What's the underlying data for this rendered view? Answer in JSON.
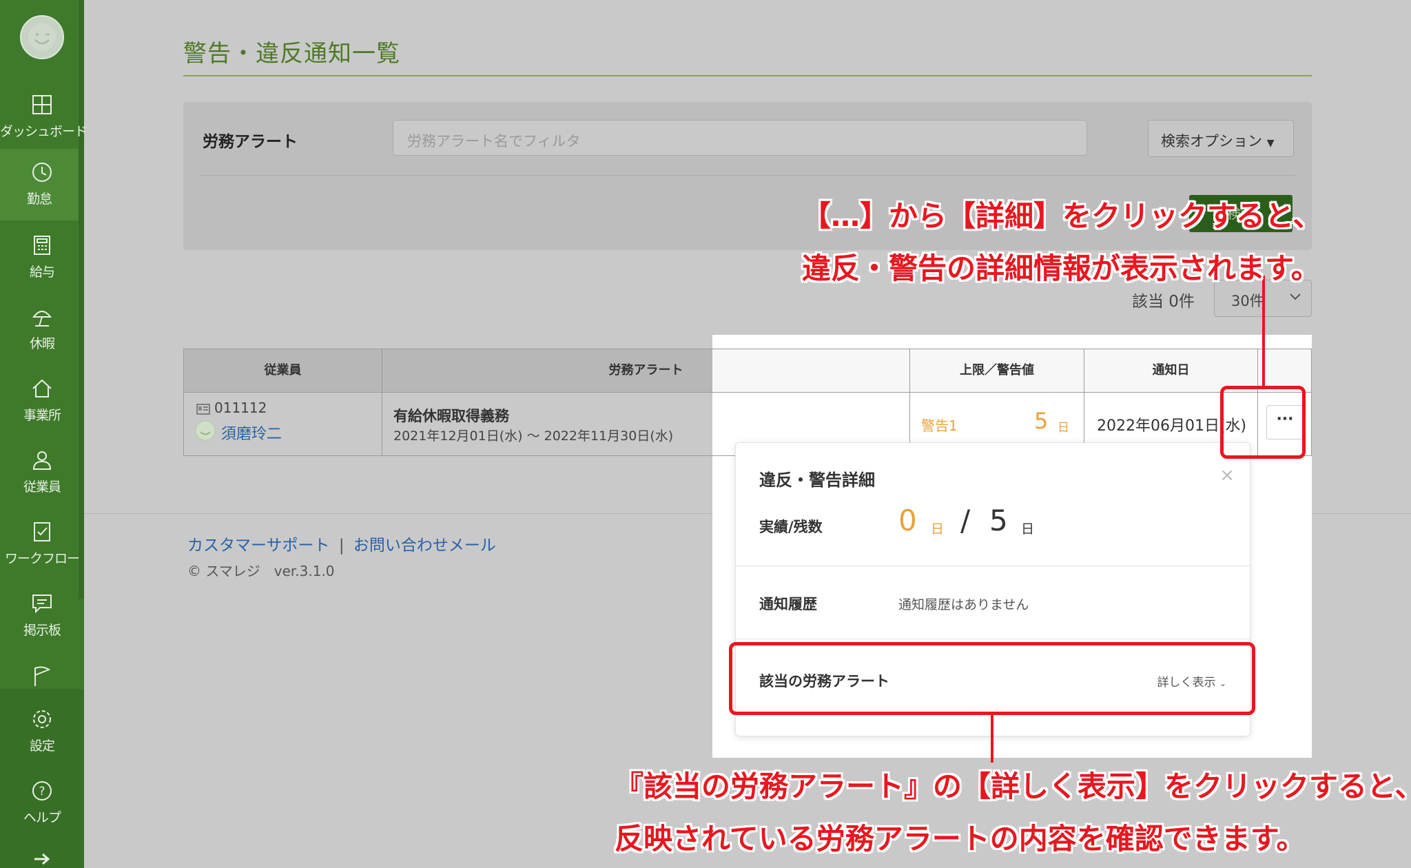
{
  "sidebar": {
    "items": [
      {
        "label": "ダッシュボード",
        "icon": "dashboard-icon"
      },
      {
        "label": "勤怠",
        "icon": "clock-icon"
      },
      {
        "label": "給与",
        "icon": "calculator-icon"
      },
      {
        "label": "休暇",
        "icon": "beach-umbrella-icon"
      },
      {
        "label": "事業所",
        "icon": "home-icon"
      },
      {
        "label": "従業員",
        "icon": "person-icon"
      },
      {
        "label": "ワークフロー",
        "icon": "clipboard-check-icon"
      },
      {
        "label": "掲示板",
        "icon": "message-icon"
      },
      {
        "label": "",
        "icon": "flag-icon"
      },
      {
        "label": "設定",
        "icon": "gear-icon"
      },
      {
        "label": "ヘルプ",
        "icon": "help-icon"
      }
    ]
  },
  "page": {
    "title": "警告・違反通知一覧"
  },
  "filter": {
    "label": "労務アラート",
    "placeholder": "労務アラート名でフィルタ",
    "search_options": "検索オプション",
    "search_button": "検索"
  },
  "results": {
    "count": "該当 0件",
    "per_page": "30件"
  },
  "table": {
    "headers": [
      "従業員",
      "労務アラート",
      "上限／警告値",
      "通知日",
      ""
    ],
    "row": {
      "employee_id": "011112",
      "employee_name": "須磨玲二",
      "alert_name": "有給休暇取得義務",
      "alert_period": "2021年12月01日(水) 〜 2022年11月30日(水)",
      "warning_label": "警告1",
      "warning_value": "5",
      "warning_unit": "日",
      "notice_date": "2022年06月01日(水)",
      "more_button": "···"
    }
  },
  "popover": {
    "title": "違反・警告詳細",
    "close": "×",
    "actual_label": "実績/残数",
    "actual_value": "0",
    "actual_unit": "日",
    "separator": "/",
    "remaining_value": "5",
    "remaining_unit": "日",
    "history_label": "通知履歴",
    "history_value": "通知履歴はありません",
    "related_label": "該当の労務アラート",
    "show_details": "詳しく表示"
  },
  "annotations": {
    "top_line1": "【…】から【詳細】をクリックすると、",
    "top_line2": "違反・警告の詳細情報が表示されます。",
    "bottom_line1": "『該当の労務アラート』の【詳しく表示】をクリックすると、",
    "bottom_line2": "反映されている労務アラートの内容を確認できます。"
  },
  "footer": {
    "support": "カスタマーサポート",
    "divider": "|",
    "contact": "お問い合わせメール",
    "copyright": "© スマレジ　ver.3.1.0"
  },
  "colors": {
    "sidebar": "#3e7a2a",
    "accent_orange": "#e9a23b",
    "annotation_red": "#e8171f",
    "link_blue": "#2a62a8"
  }
}
